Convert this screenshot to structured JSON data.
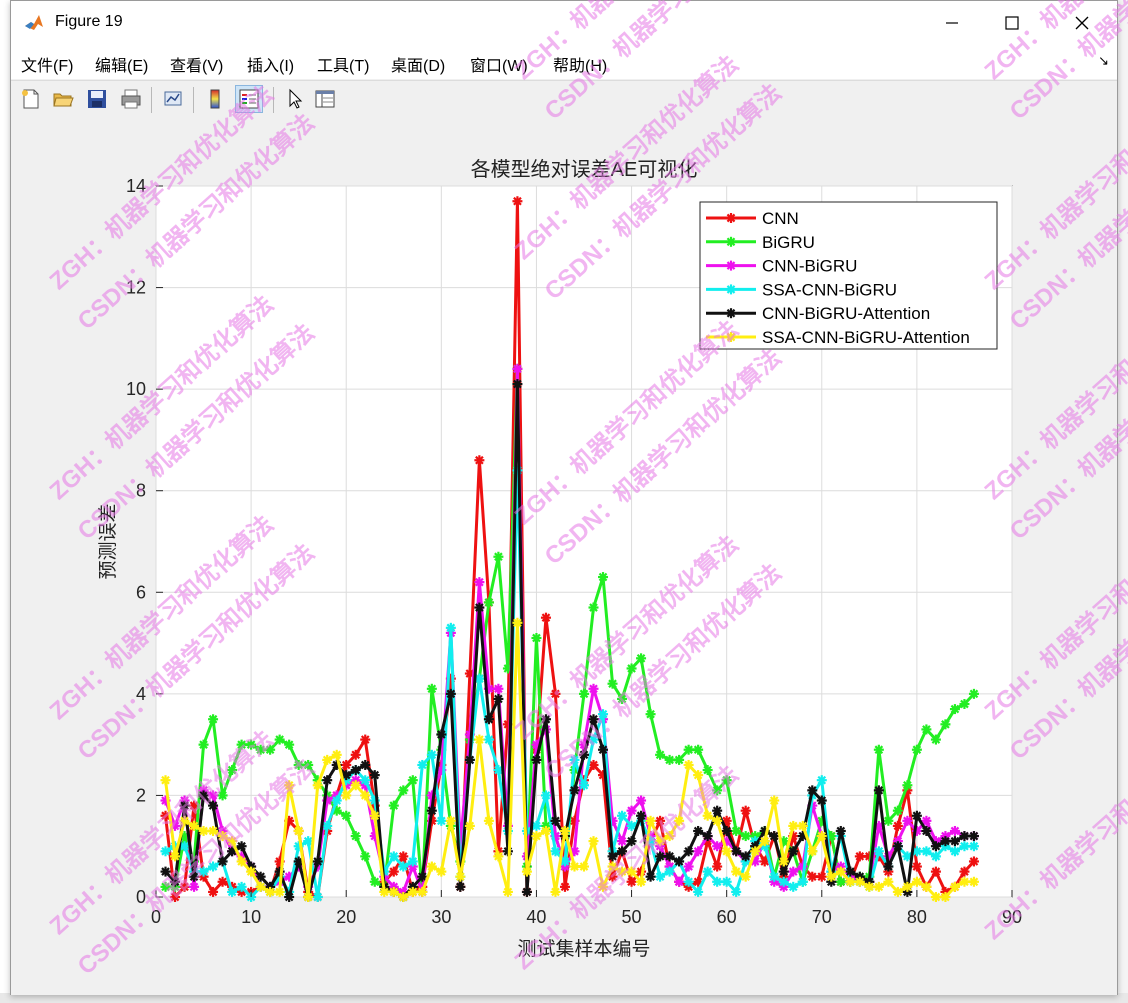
{
  "window": {
    "title": "Figure 19"
  },
  "menu": [
    "文件(F)",
    "编辑(E)",
    "查看(V)",
    "插入(I)",
    "工具(T)",
    "桌面(D)",
    "窗口(W)",
    "帮助(H)"
  ],
  "watermarks": [
    "ZGH：机器学习和优化算法",
    "CSDN：机器学习和优化算法"
  ],
  "chart_data": {
    "type": "line",
    "title": "各模型绝对误差AE可视化",
    "xlabel": "测试集样本编号",
    "ylabel": "预测误差",
    "xlim": [
      0,
      90
    ],
    "ylim": [
      0,
      14
    ],
    "xticks": [
      0,
      10,
      20,
      30,
      40,
      50,
      60,
      70,
      80,
      90
    ],
    "yticks": [
      0,
      2,
      4,
      6,
      8,
      10,
      12,
      14
    ],
    "grid": true,
    "legend_position": "top-right",
    "x": [
      1,
      2,
      3,
      4,
      5,
      6,
      7,
      8,
      9,
      10,
      11,
      12,
      13,
      14,
      15,
      16,
      17,
      18,
      19,
      20,
      21,
      22,
      23,
      24,
      25,
      26,
      27,
      28,
      29,
      30,
      31,
      32,
      33,
      34,
      35,
      36,
      37,
      38,
      39,
      40,
      41,
      42,
      43,
      44,
      45,
      46,
      47,
      48,
      49,
      50,
      51,
      52,
      53,
      54,
      55,
      56,
      57,
      58,
      59,
      60,
      61,
      62,
      63,
      64,
      65,
      66,
      67,
      68,
      69,
      70,
      71,
      72,
      73,
      74,
      75,
      76,
      77,
      78,
      79,
      80,
      81,
      82,
      83,
      84,
      85,
      86
    ],
    "series": [
      {
        "name": "CNN",
        "color": "#ee1111",
        "values": [
          1.6,
          0.0,
          0.2,
          1.8,
          0.4,
          0.1,
          0.3,
          0.2,
          0.1,
          0.1,
          0.2,
          0.1,
          0.7,
          1.5,
          1.3,
          0.1,
          0.0,
          1.3,
          2.0,
          2.6,
          2.8,
          3.1,
          1.8,
          0.3,
          0.5,
          0.8,
          0.1,
          0.2,
          1.5,
          2.6,
          4.3,
          0.2,
          4.4,
          8.6,
          5.8,
          0.9,
          3.4,
          13.7,
          0.1,
          2.9,
          5.5,
          4.0,
          0.2,
          1.5,
          2.3,
          2.6,
          2.4,
          0.4,
          0.9,
          0.3,
          0.5,
          1.1,
          1.5,
          0.6,
          0.3,
          0.2,
          0.3,
          1.1,
          0.6,
          1.5,
          0.9,
          1.7,
          1.0,
          0.7,
          1.2,
          0.4,
          1.2,
          0.6,
          0.4,
          0.4,
          1.2,
          0.3,
          0.3,
          0.8,
          0.8,
          0.8,
          0.5,
          1.4,
          2.1,
          0.6,
          0.2,
          0.5,
          0.1,
          0.2,
          0.5,
          0.7
        ]
      },
      {
        "name": "BiGRU",
        "color": "#22ee22",
        "values": [
          0.2,
          0.2,
          1.2,
          0.7,
          3.0,
          3.5,
          2.0,
          2.5,
          3.0,
          3.0,
          2.9,
          2.9,
          3.1,
          3.0,
          2.6,
          2.6,
          2.3,
          2.0,
          1.7,
          1.6,
          1.2,
          0.8,
          0.3,
          0.2,
          1.8,
          2.1,
          2.3,
          0.1,
          4.1,
          2.9,
          1.4,
          0.7,
          3.1,
          4.3,
          5.8,
          6.7,
          4.5,
          10.4,
          0.6,
          5.1,
          1.4,
          1.2,
          0.6,
          2.5,
          4.0,
          5.7,
          6.3,
          4.2,
          3.9,
          4.5,
          4.7,
          3.6,
          2.8,
          2.7,
          2.7,
          2.9,
          2.9,
          2.5,
          2.1,
          2.3,
          1.3,
          1.2,
          1.2,
          1.3,
          0.4,
          1.1,
          0.9,
          0.3,
          0.9,
          1.5,
          1.2,
          0.3,
          0.3,
          0.4,
          0.4,
          2.9,
          1.5,
          1.7,
          2.2,
          2.9,
          3.3,
          3.1,
          3.4,
          3.7,
          3.8,
          4.0
        ]
      },
      {
        "name": "CNN-BiGRU",
        "color": "#ee11ee",
        "values": [
          1.9,
          1.4,
          1.9,
          0.2,
          2.1,
          2.0,
          1.3,
          0.9,
          0.8,
          0.6,
          0.2,
          0.2,
          0.3,
          0.4,
          0.6,
          0.2,
          0.6,
          1.9,
          2.0,
          2.2,
          2.3,
          2.2,
          1.2,
          0.4,
          0.2,
          0.1,
          0.6,
          0.1,
          2.0,
          2.5,
          5.2,
          1.0,
          3.2,
          6.2,
          4.1,
          4.1,
          1.4,
          10.4,
          0.8,
          3.0,
          3.3,
          1.2,
          0.6,
          0.9,
          3.0,
          4.1,
          3.5,
          1.5,
          1.1,
          1.7,
          1.9,
          1.2,
          1.0,
          0.6,
          0.3,
          0.6,
          0.9,
          1.2,
          1.0,
          1.1,
          0.9,
          0.7,
          0.7,
          1.1,
          0.3,
          0.2,
          0.5,
          0.6,
          1.8,
          1.2,
          0.5,
          0.6,
          0.4,
          0.3,
          0.3,
          1.4,
          0.8,
          1.1,
          1.5,
          1.3,
          1.5,
          1.1,
          1.2,
          1.3,
          1.2,
          1.2
        ]
      },
      {
        "name": "SSA-CNN-BiGRU",
        "color": "#11eeee",
        "values": [
          0.9,
          1.0,
          1.0,
          0.5,
          0.5,
          0.6,
          0.7,
          0.1,
          0.2,
          0.0,
          0.2,
          0.1,
          0.4,
          0.1,
          1.0,
          1.1,
          0.0,
          1.4,
          1.9,
          2.3,
          2.5,
          2.3,
          1.9,
          0.5,
          0.8,
          0.6,
          0.7,
          2.6,
          2.8,
          1.5,
          5.3,
          0.4,
          2.7,
          4.3,
          3.1,
          2.5,
          1.3,
          8.4,
          1.3,
          1.4,
          2.0,
          0.9,
          0.7,
          2.7,
          2.2,
          3.1,
          3.6,
          0.9,
          1.6,
          1.4,
          1.5,
          1.1,
          0.4,
          0.5,
          0.7,
          0.3,
          0.1,
          0.5,
          0.3,
          0.3,
          0.1,
          0.7,
          1.1,
          1.0,
          0.4,
          0.3,
          0.2,
          0.3,
          2.0,
          2.3,
          0.5,
          1.2,
          0.3,
          0.3,
          0.2,
          0.9,
          0.6,
          1.0,
          0.8,
          0.9,
          0.9,
          0.8,
          1.0,
          0.9,
          1.0,
          1.0
        ]
      },
      {
        "name": "CNN-BiGRU-Attention",
        "color": "#111111",
        "values": [
          0.5,
          0.3,
          1.8,
          0.4,
          2.0,
          1.8,
          0.7,
          0.9,
          1.0,
          0.6,
          0.4,
          0.2,
          0.5,
          0.0,
          0.7,
          0.0,
          0.7,
          2.3,
          2.6,
          2.4,
          2.5,
          2.6,
          2.4,
          0.2,
          0.1,
          0.0,
          0.2,
          0.4,
          1.7,
          3.2,
          4.0,
          0.2,
          2.7,
          5.7,
          3.5,
          3.9,
          0.9,
          10.1,
          0.1,
          2.7,
          3.5,
          1.5,
          1.2,
          2.1,
          2.8,
          3.5,
          2.9,
          0.8,
          0.9,
          1.1,
          1.6,
          0.4,
          0.8,
          0.8,
          0.7,
          0.9,
          1.3,
          1.2,
          1.7,
          1.3,
          0.9,
          0.8,
          1.0,
          1.3,
          1.2,
          0.5,
          0.9,
          1.2,
          2.1,
          1.9,
          0.3,
          1.3,
          0.5,
          0.4,
          0.3,
          2.1,
          0.6,
          1.0,
          0.1,
          1.6,
          1.3,
          1.0,
          1.1,
          1.1,
          1.2,
          1.2
        ]
      },
      {
        "name": "SSA-CNN-BiGRU-Attention",
        "color": "#ffee11",
        "values": [
          2.3,
          0.8,
          1.5,
          1.4,
          1.3,
          1.3,
          1.2,
          1.1,
          0.7,
          0.5,
          0.2,
          0.1,
          0.1,
          2.2,
          1.3,
          0.0,
          2.2,
          2.7,
          2.8,
          2.0,
          2.2,
          2.0,
          1.6,
          0.1,
          0.1,
          0.0,
          0.1,
          0.1,
          0.6,
          0.5,
          1.5,
          0.4,
          1.4,
          3.1,
          1.5,
          0.8,
          0.1,
          5.4,
          0.5,
          1.2,
          1.3,
          0.1,
          1.3,
          0.6,
          0.6,
          1.1,
          0.2,
          0.6,
          0.5,
          0.5,
          0.3,
          1.5,
          1.1,
          1.2,
          1.5,
          2.6,
          2.4,
          1.6,
          1.5,
          0.9,
          0.5,
          0.4,
          0.9,
          1.1,
          1.9,
          0.7,
          1.4,
          1.4,
          0.9,
          1.2,
          0.4,
          0.5,
          0.3,
          0.3,
          0.2,
          0.2,
          0.3,
          0.1,
          0.2,
          0.3,
          0.2,
          0.0,
          0.0,
          0.2,
          0.3,
          0.3
        ]
      }
    ]
  }
}
